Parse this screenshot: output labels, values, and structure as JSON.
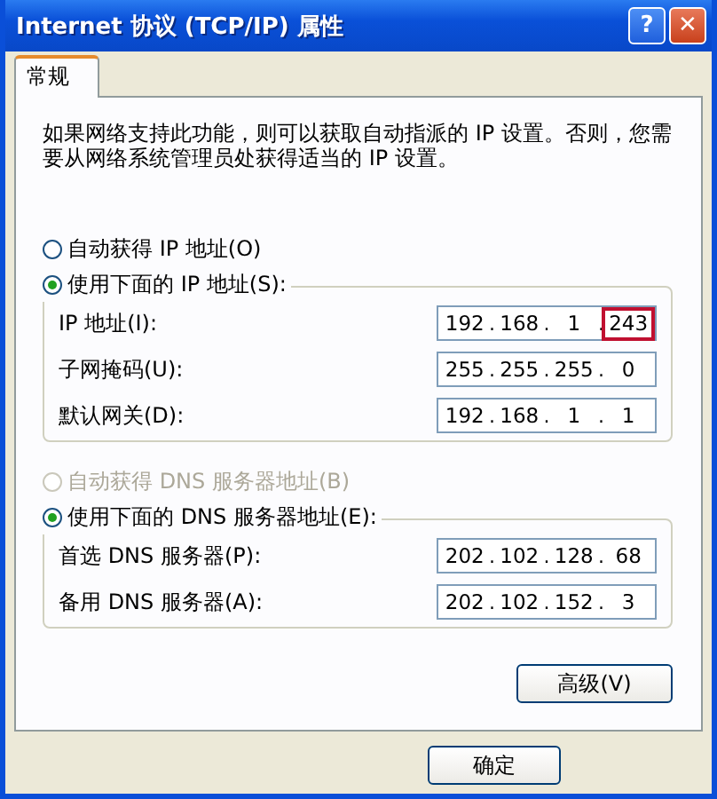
{
  "window": {
    "title": "Internet 协议 (TCP/IP) 属性",
    "buttons": [
      {
        "kind": "help",
        "label": "?"
      },
      {
        "kind": "close",
        "label": "✕"
      }
    ]
  },
  "tabs": [
    {
      "label": "常规",
      "selected": true
    }
  ],
  "description": "如果网络支持此功能，则可以获取自动指派的 IP 设置。否则，您需要从网络系统管理员处获得适当的 IP 设置。",
  "ip_mode": [
    {
      "label": "自动获得 IP 地址(O)",
      "selected": false,
      "disabled": false
    },
    {
      "label": "使用下面的 IP 地址(S):",
      "selected": true,
      "disabled": false
    }
  ],
  "ip_fields": [
    {
      "label": "IP 地址(I):",
      "octets": [
        {
          "value": "192",
          "highlighted": false
        },
        {
          "separator": ".",
          "value": "168",
          "highlighted": false
        },
        {
          "separator": ".",
          "value": "1",
          "highlighted": false
        },
        {
          "separator": ".",
          "value": "243",
          "highlighted": true
        }
      ]
    },
    {
      "label": "子网掩码(U):",
      "octets": [
        {
          "value": "255",
          "highlighted": false
        },
        {
          "separator": ".",
          "value": "255",
          "highlighted": false
        },
        {
          "separator": ".",
          "value": "255",
          "highlighted": false
        },
        {
          "separator": ".",
          "value": "0",
          "highlighted": false
        }
      ]
    },
    {
      "label": "默认网关(D):",
      "octets": [
        {
          "value": "192",
          "highlighted": false
        },
        {
          "separator": ".",
          "value": "168",
          "highlighted": false
        },
        {
          "separator": ".",
          "value": "1",
          "highlighted": false
        },
        {
          "separator": ".",
          "value": "1",
          "highlighted": false
        }
      ]
    }
  ],
  "dns_mode": [
    {
      "label": "自动获得 DNS 服务器地址(B)",
      "selected": false,
      "disabled": true
    },
    {
      "label": "使用下面的 DNS 服务器地址(E):",
      "selected": true,
      "disabled": false
    }
  ],
  "dns_fields": [
    {
      "label": "首选 DNS 服务器(P):",
      "octets": [
        {
          "value": "202",
          "highlighted": false
        },
        {
          "separator": ".",
          "value": "102",
          "highlighted": false
        },
        {
          "separator": ".",
          "value": "128",
          "highlighted": false
        },
        {
          "separator": ".",
          "value": "68",
          "highlighted": false
        }
      ]
    },
    {
      "label": "备用 DNS 服务器(A):",
      "octets": [
        {
          "value": "202",
          "highlighted": false
        },
        {
          "separator": ".",
          "value": "102",
          "highlighted": false
        },
        {
          "separator": ".",
          "value": "152",
          "highlighted": false
        },
        {
          "separator": ".",
          "value": "3",
          "highlighted": false
        }
      ]
    }
  ],
  "advanced_button": "高级(V)",
  "footer_buttons": [
    "确定"
  ]
}
